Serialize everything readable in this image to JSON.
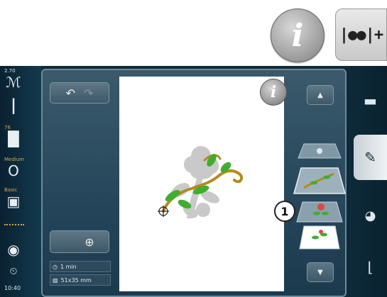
{
  "top": {
    "info_button_label": "i",
    "multi_button_label": "|●●|+"
  },
  "left_status": {
    "value_top": "2.70",
    "needle_number": "76",
    "hoop_label": "Medium",
    "bobbin_label": "Basic"
  },
  "left_status_time": "10:40",
  "panel": {
    "info_label": "i",
    "callout_number": "1",
    "time_value": "1 min",
    "size_value": "51x35 mm"
  },
  "icons": {
    "undo": "undo-icon",
    "redo": "redo-icon",
    "zoom": "zoom-icon",
    "scroll_up": "chevron-up-icon",
    "scroll_down": "chevron-down-icon"
  }
}
